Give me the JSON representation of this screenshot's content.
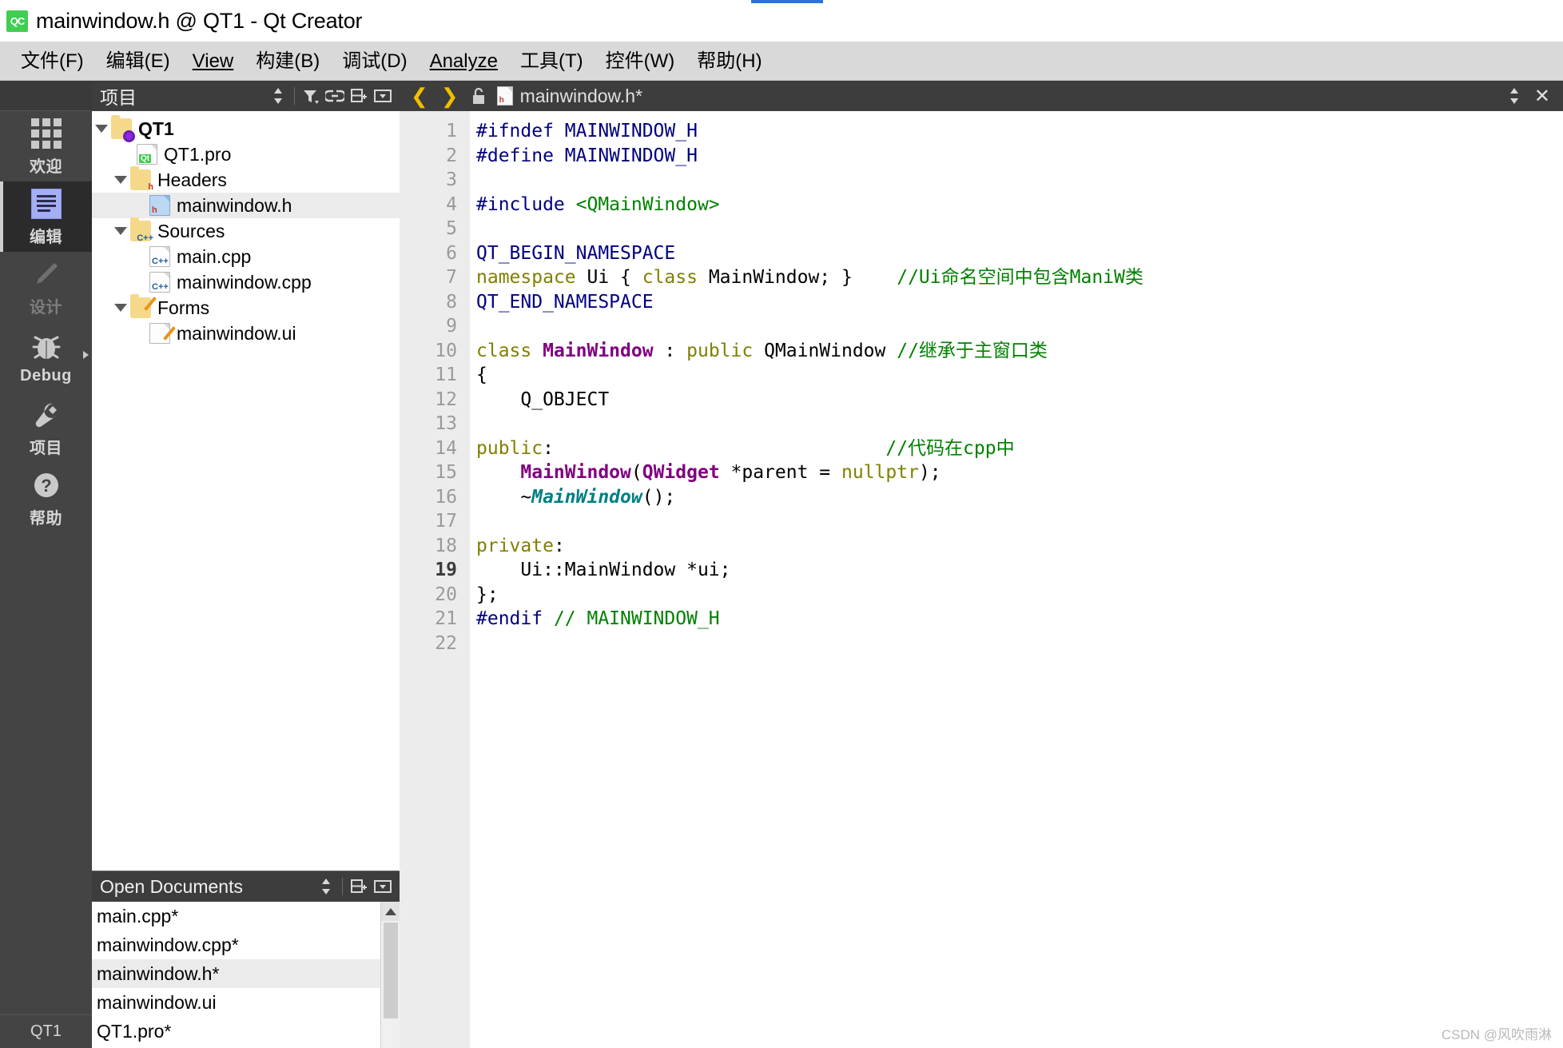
{
  "window": {
    "title": "mainwindow.h @ QT1 - Qt Creator",
    "logo_text": "QC"
  },
  "menubar": {
    "items": [
      {
        "label": "文件(F)",
        "mnemonic": "F"
      },
      {
        "label": "编辑(E)",
        "mnemonic": "E"
      },
      {
        "label": "View",
        "mnemonic": "V"
      },
      {
        "label": "构建(B)",
        "mnemonic": "B"
      },
      {
        "label": "调试(D)",
        "mnemonic": "D"
      },
      {
        "label": "Analyze",
        "mnemonic": "A"
      },
      {
        "label": "工具(T)",
        "mnemonic": "T"
      },
      {
        "label": "控件(W)",
        "mnemonic": "W"
      },
      {
        "label": "帮助(H)",
        "mnemonic": "H"
      }
    ]
  },
  "modebar": {
    "items": [
      {
        "label": "欢迎",
        "icon": "grid-icon",
        "state": "normal"
      },
      {
        "label": "编辑",
        "icon": "document-lines-icon",
        "state": "active"
      },
      {
        "label": "设计",
        "icon": "pencil-icon",
        "state": "disabled"
      },
      {
        "label": "Debug",
        "icon": "bug-icon",
        "state": "normal"
      },
      {
        "label": "项目",
        "icon": "wrench-icon",
        "state": "normal"
      },
      {
        "label": "帮助",
        "icon": "question-mark-icon",
        "state": "normal"
      }
    ],
    "bottom_label": "QT1"
  },
  "project_panel": {
    "title": "项目",
    "buttons": [
      "sync-icon",
      "filter-icon",
      "link-icon",
      "split-icon",
      "menu-icon"
    ],
    "tree": [
      {
        "label": "QT1",
        "icon": "folder-gear-icon",
        "depth": 0,
        "expanded": true,
        "bold": true,
        "selected": false
      },
      {
        "label": "QT1.pro",
        "icon": "qt-file-icon",
        "depth": 1,
        "expanded": null,
        "bold": false,
        "selected": false
      },
      {
        "label": "Headers",
        "icon": "folder-h-icon",
        "depth": 1,
        "expanded": true,
        "bold": false,
        "selected": false
      },
      {
        "label": "mainwindow.h",
        "icon": "header-file-icon",
        "depth": 2,
        "expanded": null,
        "bold": false,
        "selected": true
      },
      {
        "label": "Sources",
        "icon": "folder-cpp-icon",
        "depth": 1,
        "expanded": true,
        "bold": false,
        "selected": false
      },
      {
        "label": "main.cpp",
        "icon": "cpp-file-icon",
        "depth": 2,
        "expanded": null,
        "bold": false,
        "selected": false
      },
      {
        "label": "mainwindow.cpp",
        "icon": "cpp-file-icon",
        "depth": 2,
        "expanded": null,
        "bold": false,
        "selected": false
      },
      {
        "label": "Forms",
        "icon": "folder-ui-icon",
        "depth": 1,
        "expanded": true,
        "bold": false,
        "selected": false
      },
      {
        "label": "mainwindow.ui",
        "icon": "ui-file-icon",
        "depth": 2,
        "expanded": null,
        "bold": false,
        "selected": false
      }
    ]
  },
  "open_documents": {
    "title": "Open Documents",
    "buttons": [
      "sync-icon",
      "split-icon",
      "menu-icon"
    ],
    "items": [
      {
        "label": "main.cpp*",
        "selected": false
      },
      {
        "label": "mainwindow.cpp*",
        "selected": false
      },
      {
        "label": "mainwindow.h*",
        "selected": true
      },
      {
        "label": "mainwindow.ui",
        "selected": false
      },
      {
        "label": "QT1.pro*",
        "selected": false
      }
    ]
  },
  "editor": {
    "tab": {
      "filename": "mainwindow.h*",
      "file_badge": "h",
      "back_arrow": "back-arrow-icon",
      "forward_arrow": "forward-arrow-icon",
      "lock_icon": "unlocked-icon",
      "split_icon": "split-icon",
      "close_icon": "close-icon"
    },
    "current_line": 19,
    "lines": [
      {
        "n": 1,
        "marker": false,
        "fold": false,
        "tokens": [
          {
            "t": "#ifndef MAINWINDOW_H",
            "c": "k-pre"
          }
        ]
      },
      {
        "n": 2,
        "marker": false,
        "fold": false,
        "tokens": [
          {
            "t": "#define MAINWINDOW_H",
            "c": "k-pre"
          }
        ]
      },
      {
        "n": 3,
        "marker": false,
        "fold": false,
        "tokens": []
      },
      {
        "n": 4,
        "marker": false,
        "fold": false,
        "tokens": [
          {
            "t": "#include ",
            "c": "k-pre"
          },
          {
            "t": "<QMainWindow>",
            "c": "k-str"
          }
        ]
      },
      {
        "n": 5,
        "marker": false,
        "fold": false,
        "tokens": []
      },
      {
        "n": 6,
        "marker": false,
        "fold": false,
        "tokens": [
          {
            "t": "QT_BEGIN_NAMESPACE",
            "c": "k-pre"
          }
        ]
      },
      {
        "n": 7,
        "marker": true,
        "fold": false,
        "tokens": [
          {
            "t": "namespace ",
            "c": "k-kw"
          },
          {
            "t": "Ui { ",
            "c": "k-pln"
          },
          {
            "t": "class ",
            "c": "k-kw"
          },
          {
            "t": "MainWindow; }    ",
            "c": "k-pln"
          },
          {
            "t": "//Ui命名空间中包含ManiW类",
            "c": "k-cmt"
          }
        ]
      },
      {
        "n": 8,
        "marker": false,
        "fold": false,
        "tokens": [
          {
            "t": "QT_END_NAMESPACE",
            "c": "k-pre"
          }
        ]
      },
      {
        "n": 9,
        "marker": false,
        "fold": false,
        "tokens": []
      },
      {
        "n": 10,
        "marker": false,
        "fold": true,
        "tokens": [
          {
            "t": "class ",
            "c": "k-kw"
          },
          {
            "t": "MainWindow",
            "c": "k-typ"
          },
          {
            "t": " : ",
            "c": "k-pln"
          },
          {
            "t": "public ",
            "c": "k-kw"
          },
          {
            "t": "QMainWindow ",
            "c": "k-pln"
          },
          {
            "t": "//继承于主窗口类",
            "c": "k-cmt"
          }
        ]
      },
      {
        "n": 11,
        "marker": false,
        "fold": false,
        "tokens": [
          {
            "t": "{",
            "c": "k-pln"
          }
        ]
      },
      {
        "n": 12,
        "marker": false,
        "fold": false,
        "tokens": [
          {
            "t": "    Q_OBJECT",
            "c": "k-pln"
          }
        ]
      },
      {
        "n": 13,
        "marker": false,
        "fold": false,
        "tokens": []
      },
      {
        "n": 14,
        "marker": true,
        "fold": false,
        "tokens": [
          {
            "t": "public",
            "c": "k-kw"
          },
          {
            "t": ":                              ",
            "c": "k-pln"
          },
          {
            "t": "//代码在cpp中",
            "c": "k-cmt"
          }
        ]
      },
      {
        "n": 15,
        "marker": false,
        "fold": false,
        "tokens": [
          {
            "t": "    ",
            "c": "k-pln"
          },
          {
            "t": "MainWindow",
            "c": "k-fn"
          },
          {
            "t": "(",
            "c": "k-pln"
          },
          {
            "t": "QWidget ",
            "c": "k-typ"
          },
          {
            "t": "*parent = ",
            "c": "k-pln"
          },
          {
            "t": "nullptr",
            "c": "k-kw"
          },
          {
            "t": ");",
            "c": "k-pln"
          }
        ]
      },
      {
        "n": 16,
        "marker": false,
        "fold": false,
        "tokens": [
          {
            "t": "    ~",
            "c": "k-pln"
          },
          {
            "t": "MainWindow",
            "c": "k-typ-i"
          },
          {
            "t": "();",
            "c": "k-pln"
          }
        ]
      },
      {
        "n": 17,
        "marker": false,
        "fold": false,
        "tokens": []
      },
      {
        "n": 18,
        "marker": true,
        "fold": false,
        "tokens": [
          {
            "t": "private",
            "c": "k-kw"
          },
          {
            "t": ":",
            "c": "k-pln"
          }
        ]
      },
      {
        "n": 19,
        "marker": true,
        "fold": false,
        "tokens": [
          {
            "t": "    Ui::MainWindow *ui;",
            "c": "k-pln"
          }
        ]
      },
      {
        "n": 20,
        "marker": false,
        "fold": false,
        "tokens": [
          {
            "t": "};",
            "c": "k-pln"
          }
        ]
      },
      {
        "n": 21,
        "marker": false,
        "fold": false,
        "tokens": [
          {
            "t": "#endif ",
            "c": "k-pre"
          },
          {
            "t": "// MAINWINDOW_H",
            "c": "k-cmt"
          }
        ]
      },
      {
        "n": 22,
        "marker": false,
        "fold": false,
        "tokens": []
      }
    ]
  },
  "watermark": "CSDN @风吹雨淋",
  "colors": {
    "menubar_bg": "#d9d9d9",
    "dock_header_bg": "#3d3d3d",
    "modebar_bg": "#444444",
    "selection_bg": "#ebebeb",
    "gutter_bg": "#ececec",
    "accent_edit": "#a3aef5",
    "marker_red": "#e31b1b",
    "fold_green": "#2e8b57",
    "qt_green": "#41cd52"
  }
}
